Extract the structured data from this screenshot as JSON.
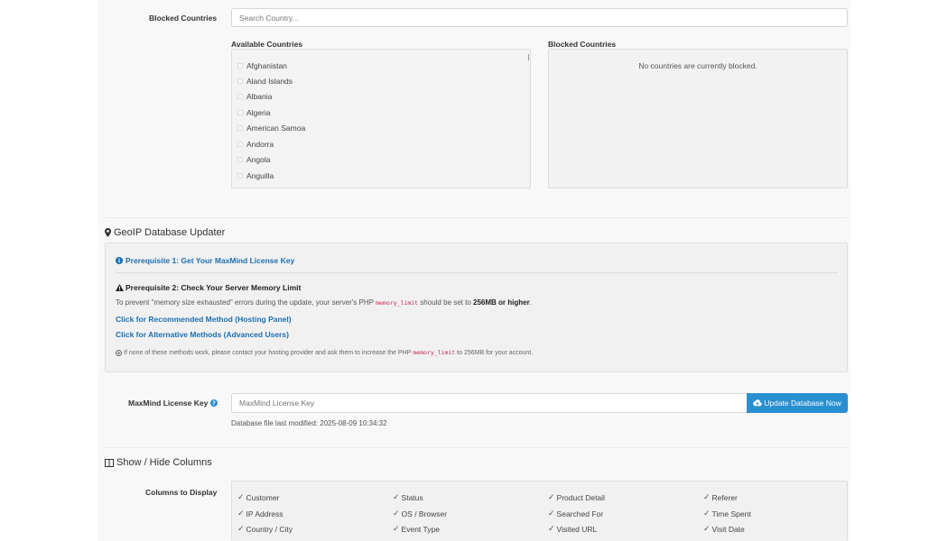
{
  "blocked": {
    "label": "Blocked Countries",
    "search_placeholder": "Search Country...",
    "available_title": "Available Countries",
    "blocked_title": "Blocked Countries",
    "available": [
      "Afghanistan",
      "Aland Islands",
      "Albania",
      "Algeria",
      "American Samoa",
      "Andorra",
      "Angola",
      "Anguilla"
    ],
    "empty_text": "No countries are currently blocked."
  },
  "geoip": {
    "title": "GeoIP Database Updater",
    "prereq1": "Prerequisite 1: Get Your MaxMind License Key",
    "prereq2": "Prerequisite 2: Check Your Server Memory Limit",
    "memory_pre": "To prevent \"memory size exhausted\" errors during the update, your server's PHP",
    "memory_code": "memory_limit",
    "memory_mid": "should be set to",
    "memory_bold": "256MB or higher",
    "memory_end": ".",
    "link_recommended": "Click for Recommended Method (Hosting Panel)",
    "link_alternative": "Click for Alternative Methods (Advanced Users)",
    "note_pre": "If none of these methods work, please contact your hosting provider and ask them to increase the PHP",
    "note_code": "memory_limit",
    "note_post": "to 256MB for your account.",
    "license_label": "MaxMind License Key",
    "license_placeholder": "MaxMind License Key",
    "update_button": "Update Database Now",
    "last_modified": "Database file last modified: 2025-08-09 10:34:32"
  },
  "columns": {
    "title": "Show / Hide Columns",
    "label": "Columns to Display",
    "items": [
      [
        "Customer",
        "Status",
        "Product Detail",
        "Referer"
      ],
      [
        "IP Address",
        "OS / Browser",
        "Searched For",
        "Time Spent"
      ],
      [
        "Country / City",
        "Event Type",
        "Visited URL",
        "Visit Date"
      ]
    ]
  }
}
